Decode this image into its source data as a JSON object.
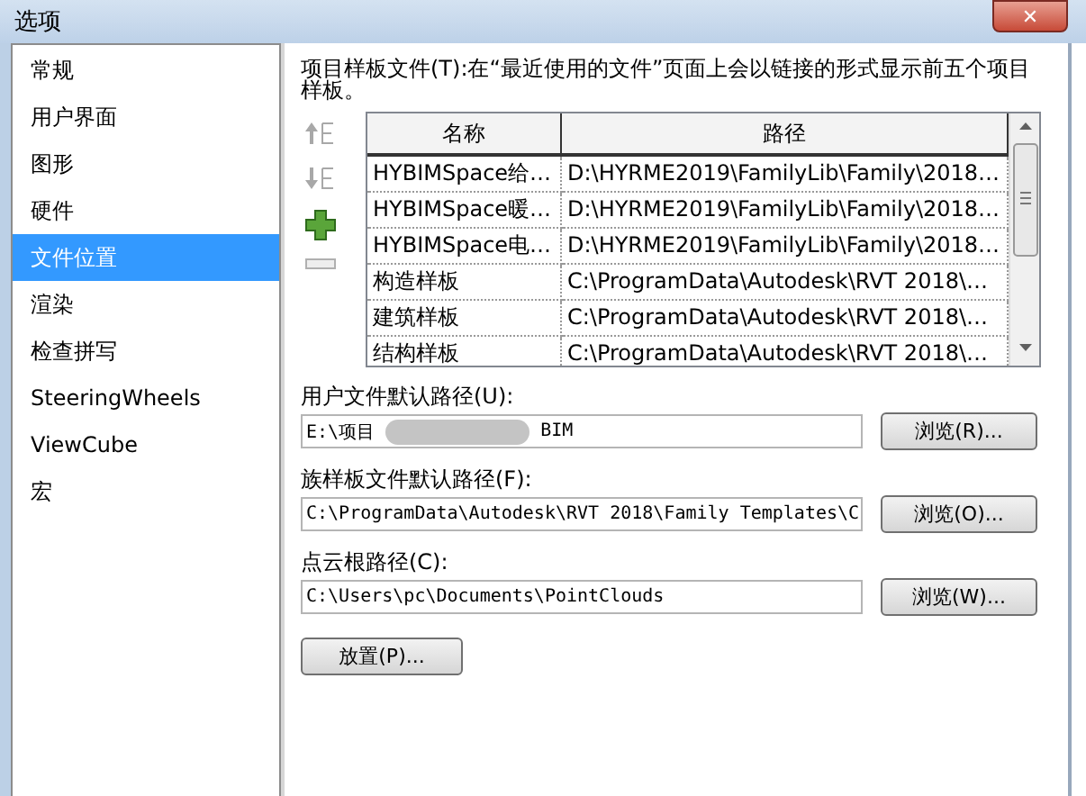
{
  "window": {
    "title": "选项",
    "close": "✕"
  },
  "sidebar": {
    "items": [
      {
        "label": "常规",
        "selected": false
      },
      {
        "label": "用户界面",
        "selected": false
      },
      {
        "label": "图形",
        "selected": false
      },
      {
        "label": "硬件",
        "selected": false
      },
      {
        "label": "文件位置",
        "selected": true
      },
      {
        "label": "渲染",
        "selected": false
      },
      {
        "label": "检查拼写",
        "selected": false
      },
      {
        "label": "SteeringWheels",
        "selected": false
      },
      {
        "label": "ViewCube",
        "selected": false
      },
      {
        "label": "宏",
        "selected": false
      }
    ]
  },
  "templates": {
    "description": "项目样板文件(T):在“最近使用的文件”页面上会以链接的形式显示前五个项目样板。",
    "toolbar": [
      {
        "kind": "up",
        "disabled": true
      },
      {
        "kind": "down",
        "disabled": true
      },
      {
        "kind": "add",
        "disabled": false
      },
      {
        "kind": "remove",
        "disabled": true
      }
    ],
    "columns": [
      "名称",
      "路径"
    ],
    "rows": [
      [
        "HYBIMSpace给…",
        "D:\\HYRME2019\\FamilyLib\\Family\\2018…"
      ],
      [
        "HYBIMSpace暖…",
        "D:\\HYRME2019\\FamilyLib\\Family\\2018…"
      ],
      [
        "HYBIMSpace电…",
        "D:\\HYRME2019\\FamilyLib\\Family\\2018…"
      ],
      [
        "构造样板",
        "C:\\ProgramData\\Autodesk\\RVT 2018\\…"
      ],
      [
        "建筑样板",
        "C:\\ProgramData\\Autodesk\\RVT 2018\\…"
      ],
      [
        "结构样板",
        "C:\\ProgramData\\Autodesk\\RVT 2018\\…"
      ]
    ]
  },
  "paths": [
    {
      "label": "用户文件默认路径(U):",
      "value_start": "E:\\项目",
      "redacted": true,
      "value_end": "BIM",
      "button": "浏览(R)..."
    },
    {
      "label": "族样板文件默认路径(F):",
      "value_start": "C:\\ProgramData\\Autodesk\\RVT 2018\\Family Templates\\C",
      "redacted": false,
      "button": "浏览(O)..."
    },
    {
      "label": "点云根路径(C):",
      "value_start": "C:\\Users\\pc\\Documents\\PointClouds",
      "redacted": false,
      "button": "浏览(W)..."
    }
  ],
  "places_button": "放置(P)..."
}
